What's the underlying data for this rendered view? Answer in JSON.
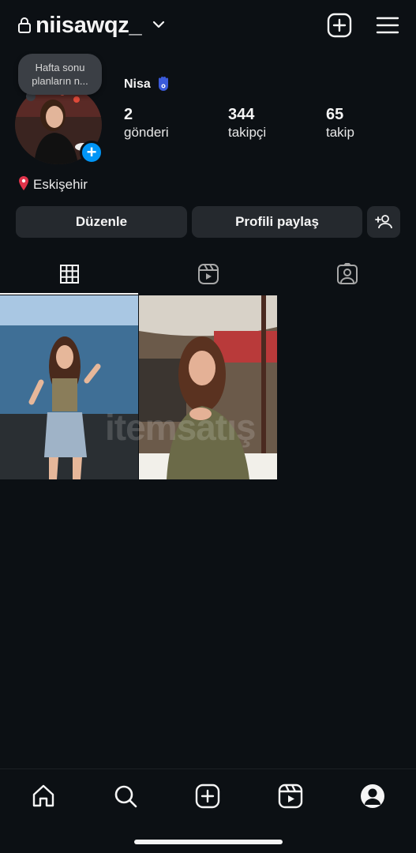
{
  "header": {
    "username": "niisawqz_",
    "lock_icon": "lock-icon",
    "dropdown_icon": "chevron-down-icon",
    "create_icon": "plus-square-icon",
    "menu_icon": "hamburger-menu-icon"
  },
  "profile": {
    "note": "Hafta sonu planların n...",
    "display_name": "Nisa",
    "name_emoji_icon": "hamsa-hand-icon",
    "add_story": "+",
    "location": "Eskişehir",
    "stats": [
      {
        "value": "2",
        "label": "gönderi"
      },
      {
        "value": "344",
        "label": "takipçi"
      },
      {
        "value": "65",
        "label": "takip"
      }
    ]
  },
  "actions": {
    "edit_label": "Düzenle",
    "share_label": "Profili paylaş",
    "discover_icon": "add-person-icon"
  },
  "tabs": [
    {
      "name": "grid",
      "icon": "grid-icon",
      "active": true
    },
    {
      "name": "reels",
      "icon": "reels-icon",
      "active": false
    },
    {
      "name": "tagged",
      "icon": "tagged-person-icon",
      "active": false
    }
  ],
  "posts_count": 2,
  "watermark": "itemsatış",
  "bottom_nav": [
    "home-icon",
    "search-icon",
    "create-icon",
    "reels-icon",
    "profile-icon"
  ],
  "colors": {
    "background": "#0c1014",
    "button": "#25292e",
    "accent": "#0095f6",
    "text": "#f5f5f5"
  }
}
